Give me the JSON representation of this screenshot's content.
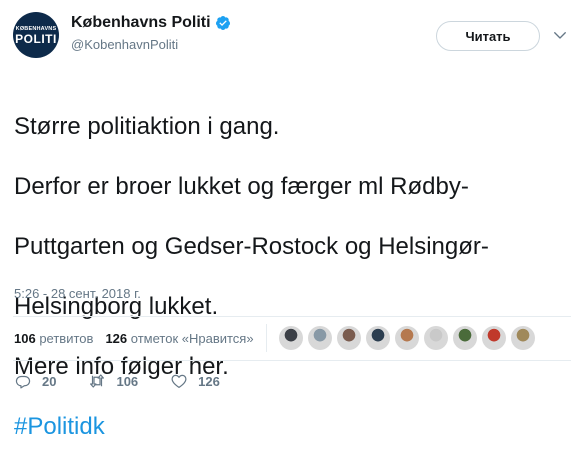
{
  "account": {
    "display_name": "Københavns Politi",
    "handle": "@KobenhavnPoliti",
    "avatar_text_small": "KØBENHAVNS",
    "avatar_text_big": "POLITI",
    "verified": true
  },
  "follow_button": {
    "label": "Читать"
  },
  "tweet": {
    "lines": [
      "Større politiaktion i gang.",
      "Derfor er broer lukket og færger ml Rødby-",
      "Puttgarten og Gedser-Rostock og Helsingør-",
      "Helsingborg lukket.",
      "Mere info følger her."
    ],
    "hashtag": "#Politidk",
    "timestamp": "5:26 - 28 сент. 2018 г."
  },
  "stats": {
    "retweets_count": "106",
    "retweets_label": "ретвитов",
    "likes_count": "126",
    "likes_label": "отметок «Нравится»"
  },
  "likers": [
    {
      "name": "liker-1",
      "color": "#3b3f46"
    },
    {
      "name": "liker-2",
      "color": "#8899a6"
    },
    {
      "name": "liker-3",
      "color": "#7a5c4f"
    },
    {
      "name": "liker-4",
      "color": "#2c3e50"
    },
    {
      "name": "liker-5",
      "color": "#b5794f"
    },
    {
      "name": "liker-6",
      "color": "#c9c9c9"
    },
    {
      "name": "liker-7",
      "color": "#4a6b3a"
    },
    {
      "name": "liker-8",
      "color": "#c0392b"
    },
    {
      "name": "liker-9",
      "color": "#a0895a"
    }
  ],
  "actions": {
    "replies": "20",
    "retweets": "106",
    "likes": "126"
  },
  "colors": {
    "link": "#1b95e0",
    "verified": "#1da1f2",
    "muted": "#657786",
    "text": "#14171a",
    "border": "#e6ecf0"
  }
}
